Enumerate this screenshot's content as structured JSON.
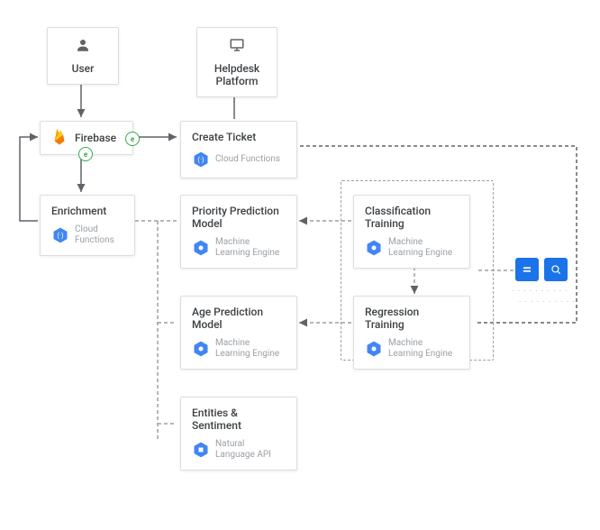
{
  "nodes": {
    "user": {
      "label": "User"
    },
    "helpdesk": {
      "label": "Helpdesk\nPlatform"
    },
    "firebase": {
      "label": "Firebase"
    },
    "create_ticket": {
      "title": "Create Ticket",
      "service": "Cloud Functions"
    },
    "enrichment": {
      "title": "Enrichment",
      "service": "Cloud Functions"
    },
    "priority_model": {
      "title": "Priority Prediction\nModel",
      "service": "Machine\nLearning Engine"
    },
    "age_model": {
      "title": "Age Prediction\nModel",
      "service": "Machine\nLearning Engine"
    },
    "entities": {
      "title": "Entities & Sentiment",
      "service": "Natural\nLanguage API"
    },
    "classification": {
      "title": "Classification\nTraining",
      "service": "Machine\nLearning Engine"
    },
    "regression": {
      "title": "Regression\nTraining",
      "service": "Machine\nLearning Engine"
    }
  },
  "training_section": {
    "label": ""
  },
  "badges": {
    "e": "e"
  },
  "floating_hint": ". . . . . . . . . ."
}
